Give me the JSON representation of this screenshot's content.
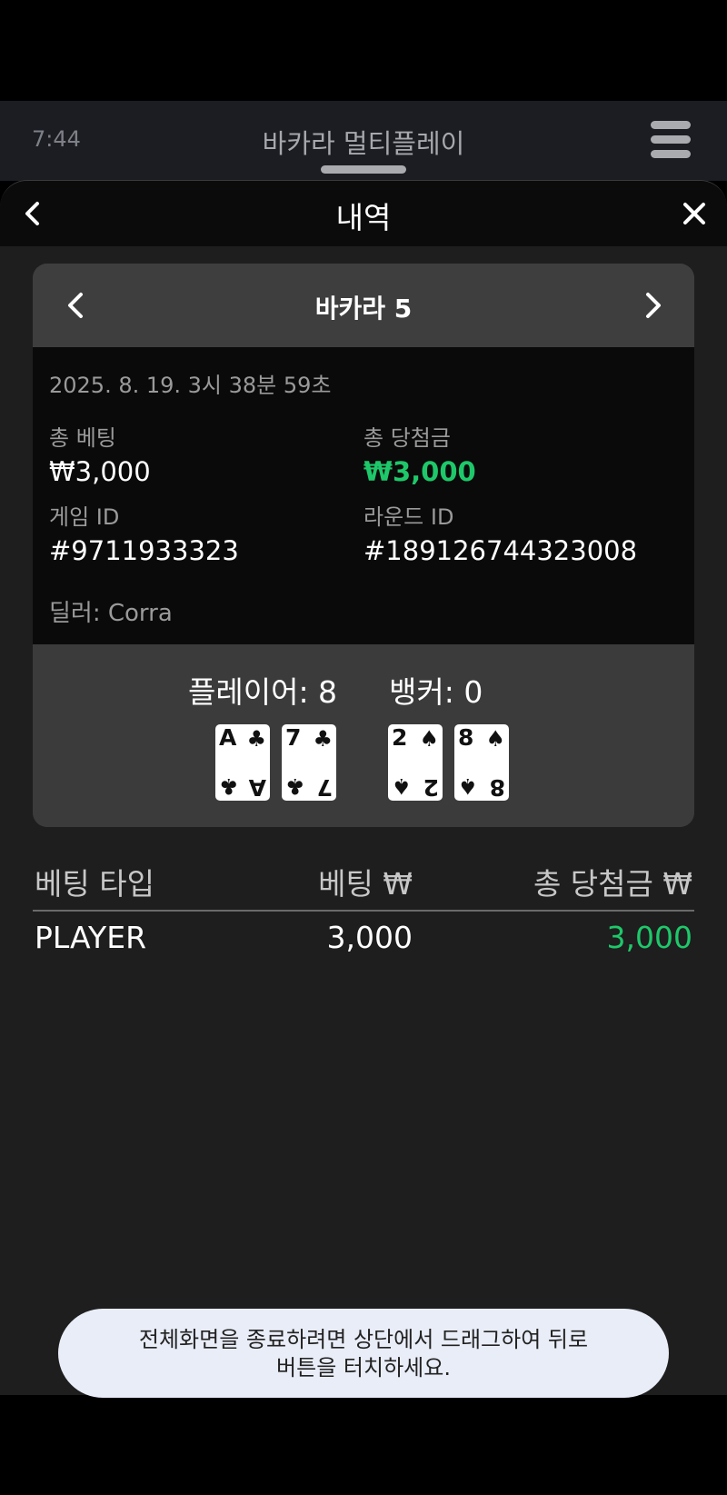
{
  "app_bar": {
    "time": "7:44",
    "title": "바카라 멀티플레이"
  },
  "sheet": {
    "title": "내역"
  },
  "game": {
    "name": "바카라 5",
    "datetime": "2025. 8. 19. 3시 38분 59초",
    "total_bet_label": "총 베팅",
    "total_bet_value": "₩3,000",
    "total_win_label": "총 당첨금",
    "total_win_value": "₩3,000",
    "game_id_label": "게임 ID",
    "game_id_value": "#9711933323",
    "round_id_label": "라운드 ID",
    "round_id_value": "#189126744323008",
    "dealer": "딜러: Corra"
  },
  "result": {
    "player_score": "플레이어: 8",
    "banker_score": "뱅커: 0",
    "player_cards": [
      {
        "rank": "A",
        "suit": "♣"
      },
      {
        "rank": "7",
        "suit": "♣"
      }
    ],
    "banker_cards": [
      {
        "rank": "2",
        "suit": "♠"
      },
      {
        "rank": "8",
        "suit": "♠"
      }
    ]
  },
  "bets_table": {
    "headers": [
      "베팅 타입",
      "베팅 ₩",
      "총 당첨금 ₩"
    ],
    "rows": [
      [
        "PLAYER",
        "3,000",
        "3,000"
      ]
    ]
  },
  "toast": {
    "line1": "전체화면을 종료하려면 상단에서 드래그하여 뒤로",
    "line2": "버튼을 터치하세요."
  },
  "colors": {
    "win_green": "#1ec86a",
    "background": "#1e1e1e"
  },
  "icons": [
    "menu-icon",
    "back-icon",
    "close-icon",
    "chevron-left-icon",
    "chevron-right-icon"
  ]
}
